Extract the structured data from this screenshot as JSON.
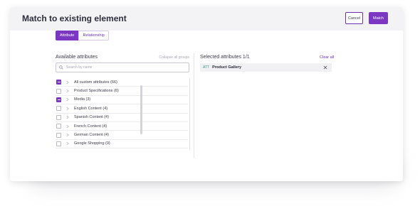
{
  "modal": {
    "title": "Match to existing element",
    "cancel_label": "Cancel",
    "match_label": "Match"
  },
  "tabs": [
    {
      "label": "Attribute",
      "active": true
    },
    {
      "label": "Relationship",
      "active": false
    }
  ],
  "available": {
    "title": "Available attributes",
    "collapse_label": "Collapse all groups",
    "search_placeholder": "Search by name",
    "items": [
      {
        "label": "All custom attributes (66)",
        "checked": true
      },
      {
        "label": "Product Specifications (6)",
        "checked": false
      },
      {
        "label": "Media (3)",
        "checked": true
      },
      {
        "label": "English Content (4)",
        "checked": false
      },
      {
        "label": "Spanish Content (4)",
        "checked": false
      },
      {
        "label": "French Content (4)",
        "checked": false
      },
      {
        "label": "German Content (4)",
        "checked": false
      },
      {
        "label": "Google Shopping (9)",
        "checked": false
      }
    ]
  },
  "selected": {
    "title": "Selected attributes 1/1",
    "clear_label": "Clear all",
    "items": [
      {
        "badge": "ATT",
        "label": "Product Gallery"
      }
    ]
  },
  "colors": {
    "accent": "#7b37c4",
    "badge": "#2f9a86"
  }
}
